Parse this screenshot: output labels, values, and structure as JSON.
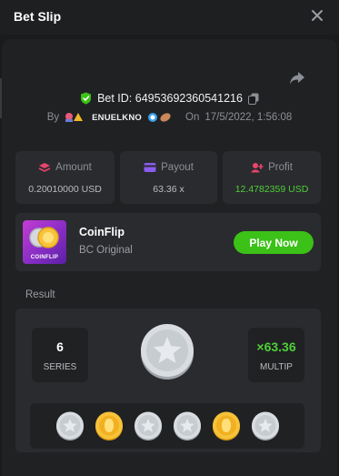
{
  "header": {
    "title": "Bet Slip"
  },
  "bet": {
    "id_label": "Bet ID: 64953692360541216",
    "by_label": "By",
    "username": "ENUELKNO",
    "on_label": "On",
    "timestamp": "17/5/2022, 1:56:08"
  },
  "stats": {
    "amount": {
      "label": "Amount",
      "value": "0.20010000 USD"
    },
    "payout": {
      "label": "Payout",
      "value": "63.36 x"
    },
    "profit": {
      "label": "Profit",
      "value": "12.4782359 USD"
    }
  },
  "game": {
    "name": "CoinFlip",
    "subtitle": "BC Original",
    "thumb_label": "COINFLIP",
    "play_label": "Play Now"
  },
  "result": {
    "section_label": "Result",
    "series_value": "6",
    "series_label": "SERIES",
    "multiplier_value": "×63.36",
    "multiplier_label": "MULTIP",
    "coins": [
      "silver-star",
      "gold",
      "silver-star",
      "silver-star",
      "gold",
      "silver-star"
    ]
  },
  "colors": {
    "accent_green": "#3bc117",
    "profit_green": "#4fcf38",
    "panel_bg": "#202123",
    "card_bg": "#2a2b2e"
  }
}
